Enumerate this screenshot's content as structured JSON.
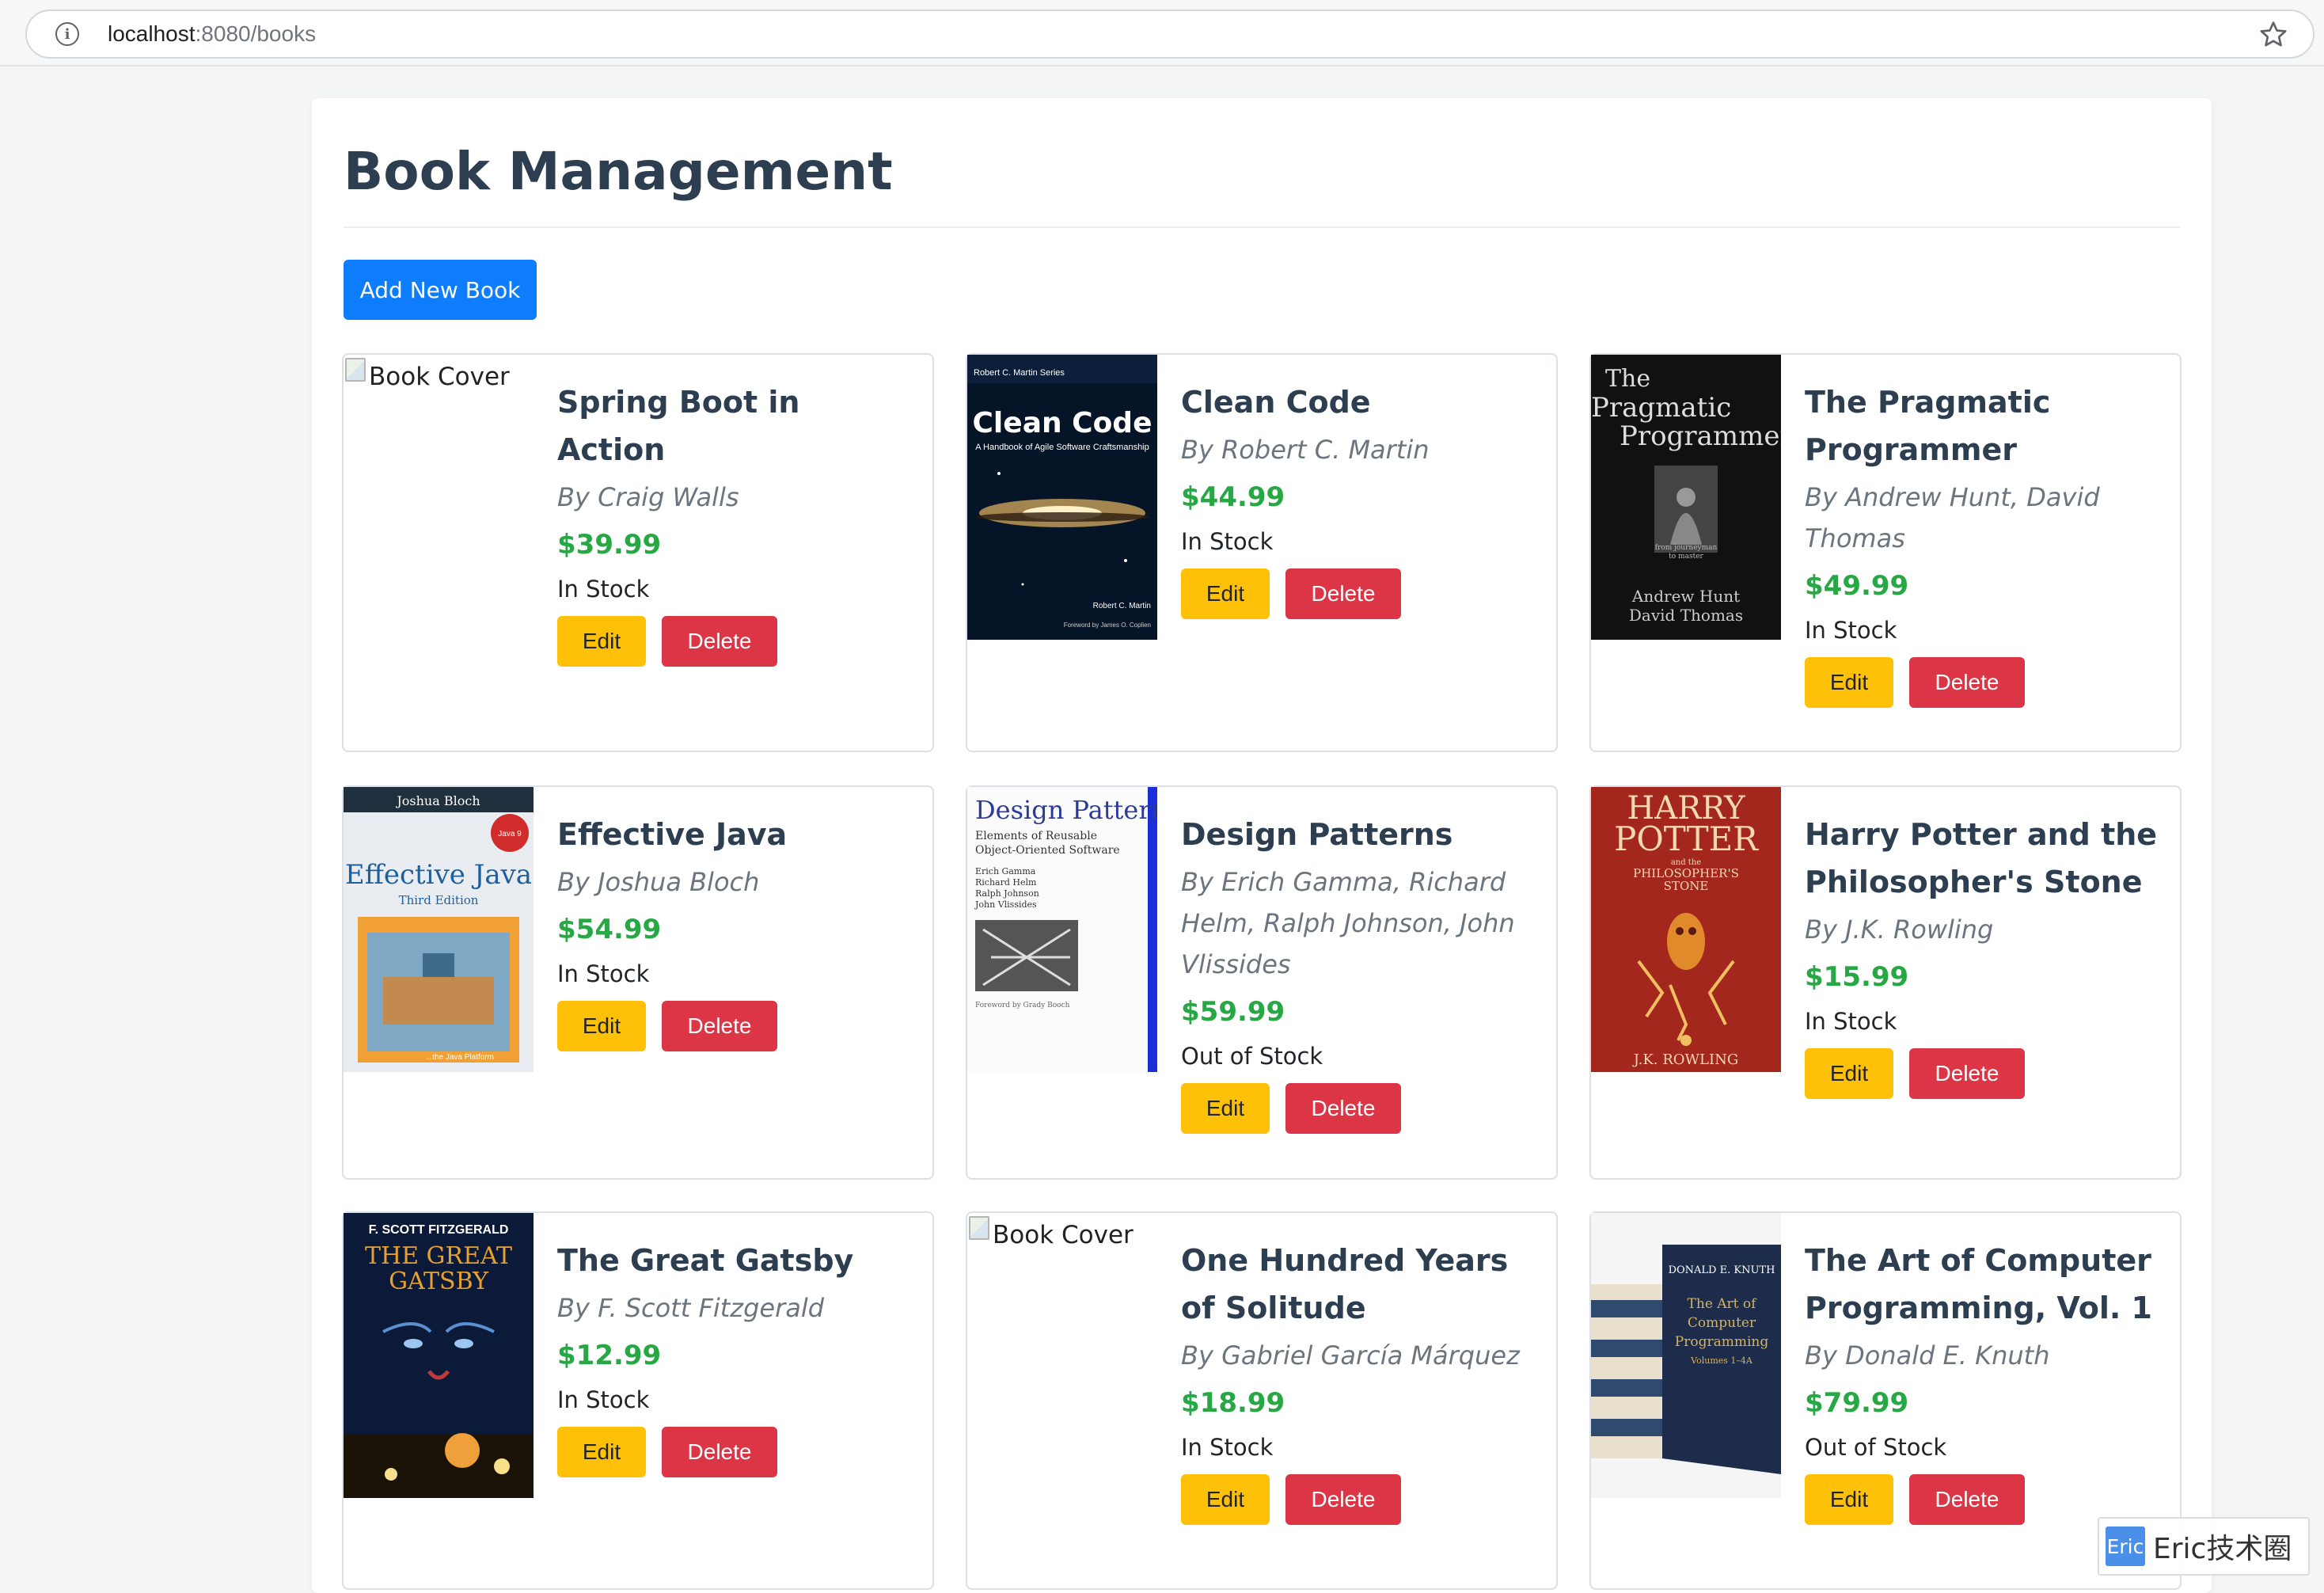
{
  "browser": {
    "url_host": "localhost",
    "url_rest": ":8080/books"
  },
  "header": {
    "title": "Book Management",
    "add_label": "Add New Book"
  },
  "labels": {
    "edit": "Edit",
    "delete": "Delete",
    "cover_alt": "Book Cover"
  },
  "books": [
    {
      "title": "Spring Boot in Action",
      "author": "By Craig Walls",
      "price": "$39.99",
      "stock": "In Stock",
      "cover": "broken"
    },
    {
      "title": "Clean Code",
      "author": "By Robert C. Martin",
      "price": "$44.99",
      "stock": "In Stock",
      "cover": "clean-code"
    },
    {
      "title": "The Pragmatic Programmer",
      "author": "By Andrew Hunt, David Thomas",
      "price": "$49.99",
      "stock": "In Stock",
      "cover": "pragmatic"
    },
    {
      "title": "Effective Java",
      "author": "By Joshua Bloch",
      "price": "$54.99",
      "stock": "In Stock",
      "cover": "effective-java"
    },
    {
      "title": "Design Patterns",
      "author": "By Erich Gamma, Richard Helm, Ralph Johnson, John Vlissides",
      "price": "$59.99",
      "stock": "Out of Stock",
      "cover": "design-patterns"
    },
    {
      "title": "Harry Potter and the Philosopher's Stone",
      "author": "By J.K. Rowling",
      "price": "$15.99",
      "stock": "In Stock",
      "cover": "harry-potter"
    },
    {
      "title": "The Great Gatsby",
      "author": "By F. Scott Fitzgerald",
      "price": "$12.99",
      "stock": "In Stock",
      "cover": "gatsby"
    },
    {
      "title": "One Hundred Years of Solitude",
      "author": "By Gabriel García Márquez",
      "price": "$18.99",
      "stock": "In Stock",
      "cover": "broken"
    },
    {
      "title": "The Art of Computer Programming, Vol. 1",
      "author": "By Donald E. Knuth",
      "price": "$79.99",
      "stock": "Out of Stock",
      "cover": "taocp"
    }
  ],
  "watermark": {
    "logo": "Eric",
    "text": "Eric技术圈"
  },
  "colors": {
    "primary": "#0d7dfd",
    "warning": "#ffc107",
    "danger": "#dc3545",
    "price": "#28a745",
    "heading": "#2c3e50"
  }
}
